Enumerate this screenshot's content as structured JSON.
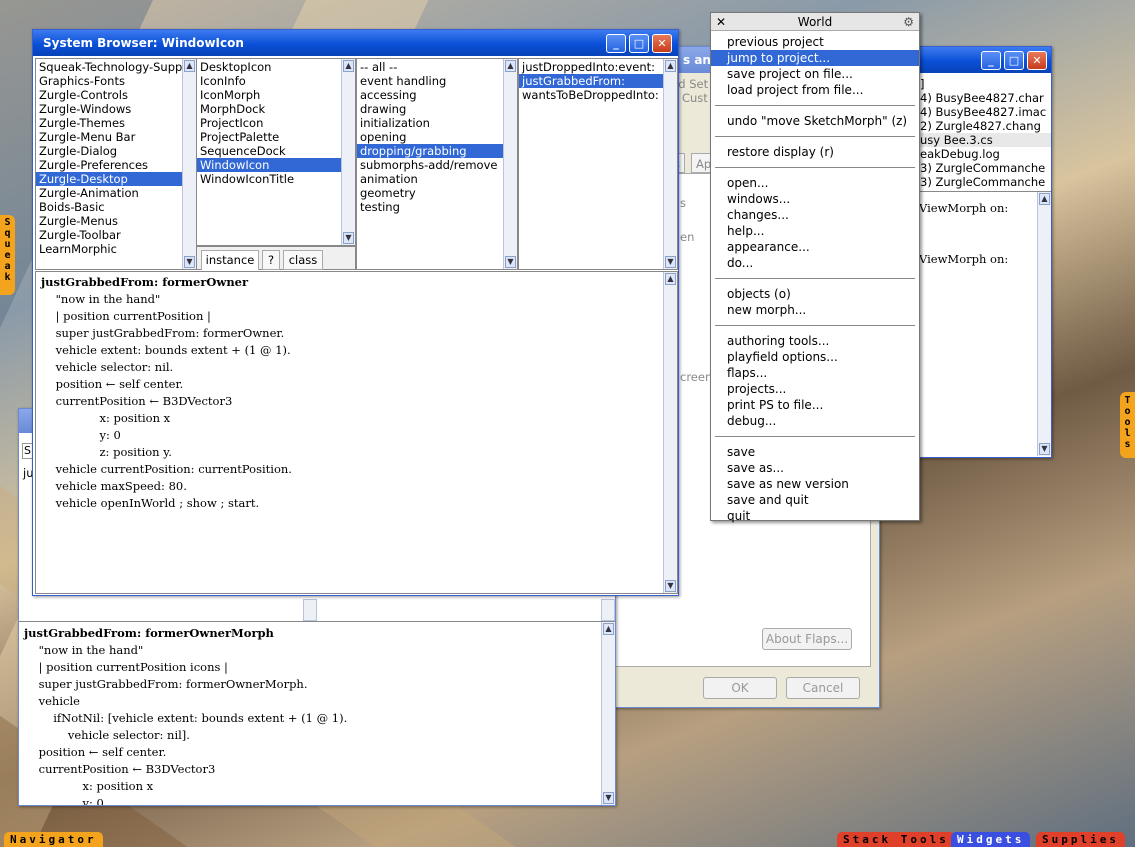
{
  "system_browser": {
    "title": "System Browser: WindowIcon",
    "categories": [
      "Squeak-Technology-Supp",
      "Graphics-Fonts",
      "Zurgle-Controls",
      "Zurgle-Windows",
      "Zurgle-Themes",
      "Zurgle-Menu Bar",
      "Zurgle-Dialog",
      "Zurgle-Preferences",
      "Zurgle-Desktop",
      "Zurgle-Animation",
      "Boids-Basic",
      "Zurgle-Menus",
      "Zurgle-Toolbar",
      "LearnMorphic"
    ],
    "classes": [
      "DesktopIcon",
      "IconInfo",
      "IconMorph",
      "MorphDock",
      "ProjectIcon",
      "ProjectPalette",
      "SequenceDock",
      "WindowIcon",
      "WindowIconTitle"
    ],
    "protocols": [
      "-- all --",
      "event handling",
      "accessing",
      "drawing",
      "initialization",
      "opening",
      "dropping/grabbing",
      "submorphs-add/remove",
      "animation",
      "geometry",
      "testing"
    ],
    "methods": [
      "justDroppedInto:event:",
      "justGrabbedFrom:",
      "wantsToBeDroppedInto:"
    ],
    "tab_instance": "instance",
    "tab_help": "?",
    "tab_class": "class",
    "code": [
      "justGrabbedFrom: formerOwner",
      "    \"now in the hand\"",
      "    | position currentPosition |",
      "    super justGrabbedFrom: formerOwner.",
      "    vehicle extent: bounds extent + (1 @ 1).",
      "    vehicle selector: nil.",
      "    position ← self center.",
      "    currentPosition ← B3DVector3",
      "                x: position x",
      "                y: 0",
      "                z: position y.",
      "    vehicle currentPosition: currentPosition.",
      "    vehicle maxSpeed: 80.",
      "    vehicle openInWorld ; show ; start."
    ]
  },
  "back_browser": {
    "search_label": "S",
    "list_label": "ju",
    "code": [
      "justGrabbedFrom: formerOwnerMorph",
      "    \"now in the hand\"",
      "    | position currentPosition icons |",
      "    super justGrabbedFrom: formerOwnerMorph.",
      "    vehicle",
      "        ifNotNil: [vehicle extent: bounds extent + (1 @ 1).",
      "            vehicle selector: nil].",
      "    position ← self center.",
      "    currentPosition ← B3DVector3",
      "                x: position x",
      "                y: 0"
    ]
  },
  "dialog": {
    "fragments": [
      "s and",
      "nd Set",
      "d Cust",
      "s",
      "Ap",
      "s",
      "en",
      "creen"
    ],
    "about_flaps": "About Flaps...",
    "ok": "OK",
    "cancel": "Cancel"
  },
  "file_list": {
    "title_fragment": "r",
    "files": [
      "]",
      "4) BusyBee4827.char",
      "4) BusyBee4827.imac",
      "2) Zurgle4827.chang",
      "usy Bee.3.cs",
      "eakDebug.log",
      "3) ZurgleCommanche",
      "3) ZurgleCommanche"
    ],
    "code": [
      "ViewMorph on:",
      "ViewMorph on:"
    ]
  },
  "world_menu": {
    "title": "World",
    "groups": [
      [
        "previous project",
        "jump to project...",
        "save project on file...",
        "load project from file..."
      ],
      [
        "undo \"move SketchMorph\" (z)"
      ],
      [
        "restore display (r)"
      ],
      [
        "open...",
        "windows...",
        "changes...",
        "help...",
        "appearance...",
        "do..."
      ],
      [
        "objects (o)",
        "new morph..."
      ],
      [
        "authoring tools...",
        "playfield options...",
        "flaps...",
        "projects...",
        "print PS to file...",
        "debug..."
      ],
      [
        "save",
        "save as...",
        "save as new version",
        "save and quit",
        "quit"
      ]
    ]
  },
  "flaps": {
    "squeak": "Squeak",
    "tools": "Tools",
    "navigator": "Navigator",
    "stack_tools": "Stack Tools",
    "widgets": "Widgets",
    "supplies": "Supplies"
  },
  "colors": {
    "selection": "#3168d5",
    "titlebar": "#0a4fd6",
    "flap_orange": "#f4a31c",
    "flap_red": "#e0402a",
    "flap_blue": "#3a4fe0"
  }
}
